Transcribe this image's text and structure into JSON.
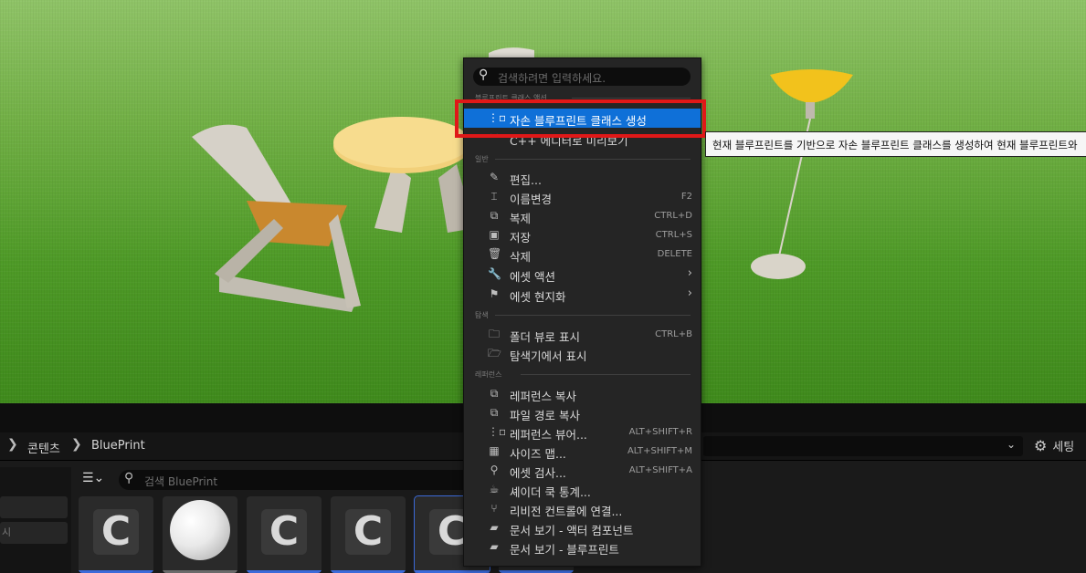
{
  "menu": {
    "search_placeholder": "검색하려면 입력하세요.",
    "sections": {
      "blueprint_class_actions": "블루프린트 클래스 액션",
      "general": "일반",
      "explore": "탐색",
      "references": "레퍼런스"
    },
    "items": [
      {
        "label": "자손 블루프린트 클래스 생성",
        "icon": "child-blueprint-icon",
        "shortcut": ""
      },
      {
        "label": "C++ 에디터로 미리보기",
        "icon": "cpp-preview-icon",
        "shortcut": ""
      },
      {
        "label": "편집...",
        "icon": "pencil-icon",
        "shortcut": ""
      },
      {
        "label": "이름변경",
        "icon": "rename-icon",
        "shortcut": "F2"
      },
      {
        "label": "복제",
        "icon": "duplicate-icon",
        "shortcut": "CTRL+D"
      },
      {
        "label": "저장",
        "icon": "save-icon",
        "shortcut": "CTRL+S"
      },
      {
        "label": "삭제",
        "icon": "trash-icon",
        "shortcut": "DELETE"
      },
      {
        "label": "에셋 액션",
        "icon": "wrench-icon",
        "shortcut": ""
      },
      {
        "label": "에셋 현지화",
        "icon": "flag-icon",
        "shortcut": ""
      },
      {
        "label": "폴더 뷰로 표시",
        "icon": "folder-search-icon",
        "shortcut": "CTRL+B"
      },
      {
        "label": "탐색기에서 표시",
        "icon": "folder-open-icon",
        "shortcut": ""
      },
      {
        "label": "레퍼런스 복사",
        "icon": "copy-reference-icon",
        "shortcut": ""
      },
      {
        "label": "파일 경로 복사",
        "icon": "copy-path-icon",
        "shortcut": ""
      },
      {
        "label": "레퍼런스 뷰어...",
        "icon": "reference-viewer-icon",
        "shortcut": "ALT+SHIFT+R"
      },
      {
        "label": "사이즈 맵...",
        "icon": "size-map-icon",
        "shortcut": "ALT+SHIFT+M"
      },
      {
        "label": "에셋 검사...",
        "icon": "audit-icon",
        "shortcut": "ALT+SHIFT+A"
      },
      {
        "label": "셰이더 쿡 통계...",
        "icon": "shader-stats-icon",
        "shortcut": ""
      },
      {
        "label": "리비전 컨트롤에 연결...",
        "icon": "source-control-icon",
        "shortcut": ""
      },
      {
        "label": "문서 보기 - 액터 컴포넌트",
        "icon": "docs-icon",
        "shortcut": ""
      },
      {
        "label": "문서 보기 - 블루프린트",
        "icon": "docs-icon",
        "shortcut": ""
      }
    ]
  },
  "tooltip": {
    "text": "현재 블루프린트를 기반으로 자손 블루프린트 클래스를 생성하여 현재 블루프린트와"
  },
  "content_browser": {
    "breadcrumb": [
      "콘텐츠",
      "BluePrint"
    ],
    "search_placeholder": "검색 BluePrint",
    "settings_label": "세팅",
    "left_panel_text": "시"
  },
  "colors": {
    "highlight": "#0f70d8",
    "annotation_box": "#e01818",
    "tile_underline": "#3b6ad9"
  }
}
